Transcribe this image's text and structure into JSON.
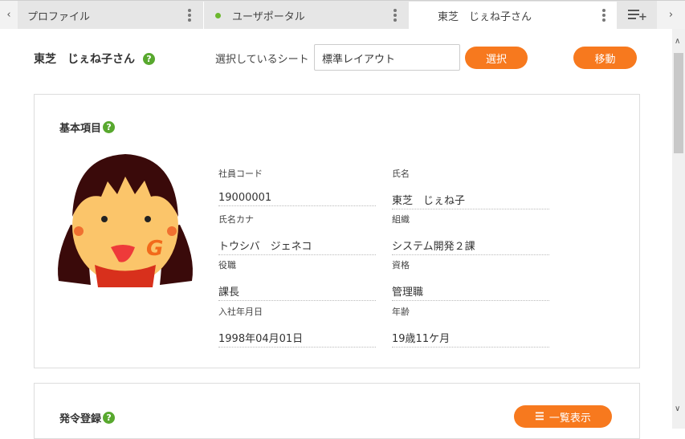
{
  "tabs": [
    {
      "label": "プロファイル",
      "active": false
    },
    {
      "label": "ユーザポータル",
      "active": false
    },
    {
      "label": "東芝　じぇね子さん",
      "active": true
    }
  ],
  "header": {
    "name": "東芝　じぇね子さん",
    "help": "?",
    "sheet_label": "選択しているシート",
    "sheet_value": "標準レイアウト",
    "select_button": "選択",
    "move_button": "移動"
  },
  "basic": {
    "title": "基本項目",
    "help": "?",
    "fields": [
      {
        "label": "社員コード",
        "value": "19000001"
      },
      {
        "label": "氏名",
        "value": "東芝　じぇね子"
      },
      {
        "label": "氏名カナ",
        "value": "トウシバ　ジェネコ"
      },
      {
        "label": "組織",
        "value": "システム開発２課"
      },
      {
        "label": "役職",
        "value": "課長"
      },
      {
        "label": "資格",
        "value": "管理職"
      },
      {
        "label": "入社年月日",
        "value": "1998年04月01日"
      },
      {
        "label": "年齢",
        "value": "19歳11ケ月"
      }
    ]
  },
  "order": {
    "title": "発令登録",
    "help": "?",
    "list_button": "一覧表示"
  },
  "colors": {
    "accent": "#f7791e",
    "help": "#58a82e"
  }
}
